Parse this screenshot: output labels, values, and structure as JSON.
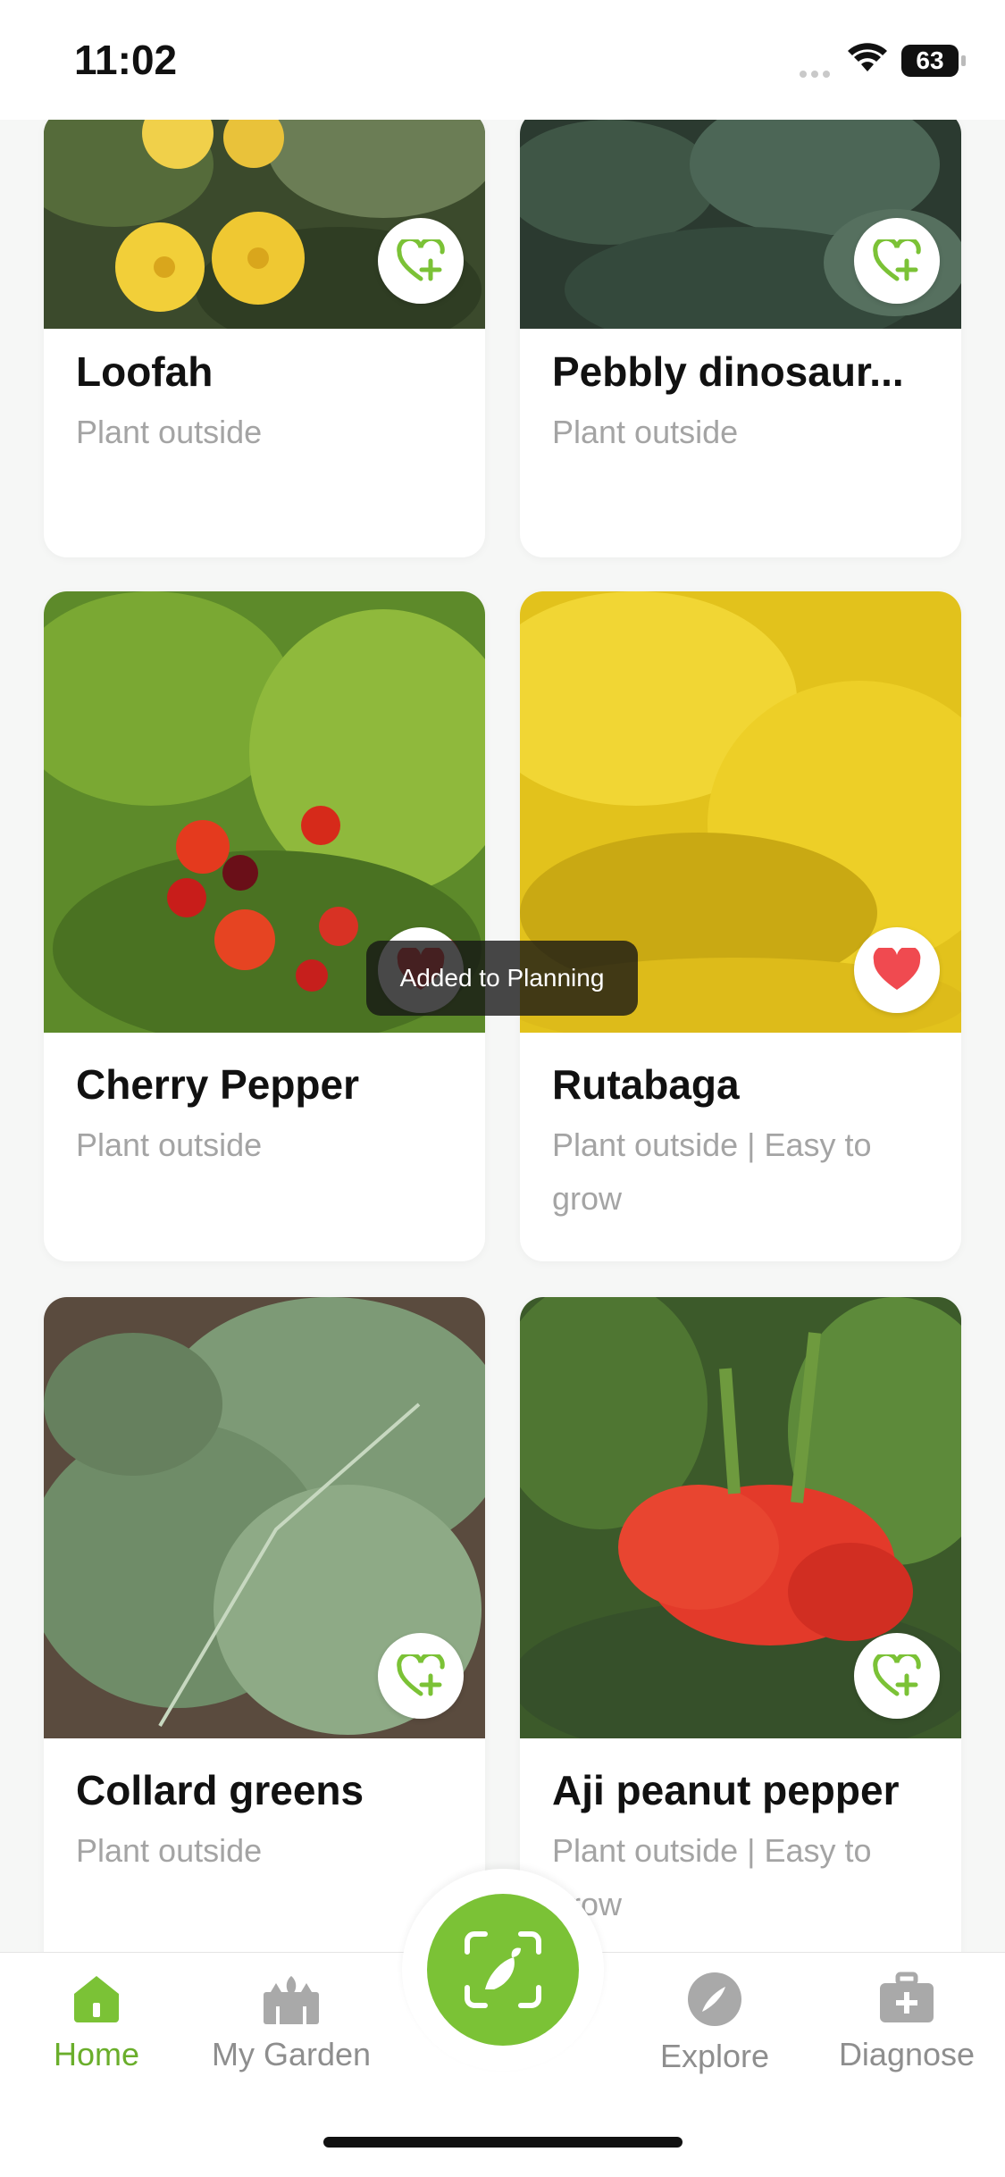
{
  "status": {
    "time": "11:02",
    "battery": "63"
  },
  "cards": [
    {
      "title": "Loofah",
      "subtitle": "Plant outside"
    },
    {
      "title": "Pebbly dinosaur...",
      "subtitle": "Plant outside"
    },
    {
      "title": "Cherry Pepper",
      "subtitle": "Plant outside"
    },
    {
      "title": "Rutabaga",
      "subtitle": "Plant outside | Easy to grow"
    },
    {
      "title": "Collard greens",
      "subtitle": "Plant outside"
    },
    {
      "title": "Aji peanut pepper",
      "subtitle": "Plant outside | Easy to grow"
    }
  ],
  "toast": "Added to Planning",
  "tabs": {
    "home": "Home",
    "garden": "My Garden",
    "explore": "Explore",
    "diagnose": "Diagnose"
  },
  "colors": {
    "accent": "#7bc236",
    "heart": "#f04a50",
    "active_tab": "#6aae2b"
  }
}
